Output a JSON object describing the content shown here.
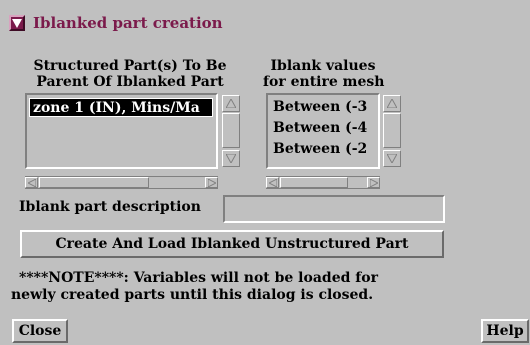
{
  "dialog": {
    "title": "Iblanked part creation",
    "title_color": "#7b1a4b",
    "background": "#c0c0c0"
  },
  "structured_parts": {
    "header_line1": "Structured Part(s) To Be",
    "header_line2": "Parent Of Iblanked Part",
    "items": [
      {
        "label": "zone 1 (IN), Mins/Ma",
        "selected": true
      }
    ]
  },
  "iblank_values": {
    "header_line1": "Iblank values",
    "header_line2": "for entire mesh",
    "items": [
      {
        "label": "Between (-3"
      },
      {
        "label": "Between (-4"
      },
      {
        "label": "Between (-2"
      }
    ]
  },
  "description": {
    "label": "Iblank part description",
    "value": "",
    "placeholder": ""
  },
  "create_button": {
    "label": "Create And Load Iblanked Unstructured Part"
  },
  "note": {
    "line1": "****NOTE****: Variables will not be loaded for",
    "line2": "newly created parts until this dialog is closed."
  },
  "footer": {
    "close_label": "Close",
    "help_label": "Help"
  },
  "icons": {
    "title_toggle": "triangle-down-icon",
    "scroll_up": "scroll-up-arrow-icon",
    "scroll_down": "scroll-down-arrow-icon",
    "scroll_left": "scroll-left-arrow-icon",
    "scroll_right": "scroll-right-arrow-icon"
  }
}
